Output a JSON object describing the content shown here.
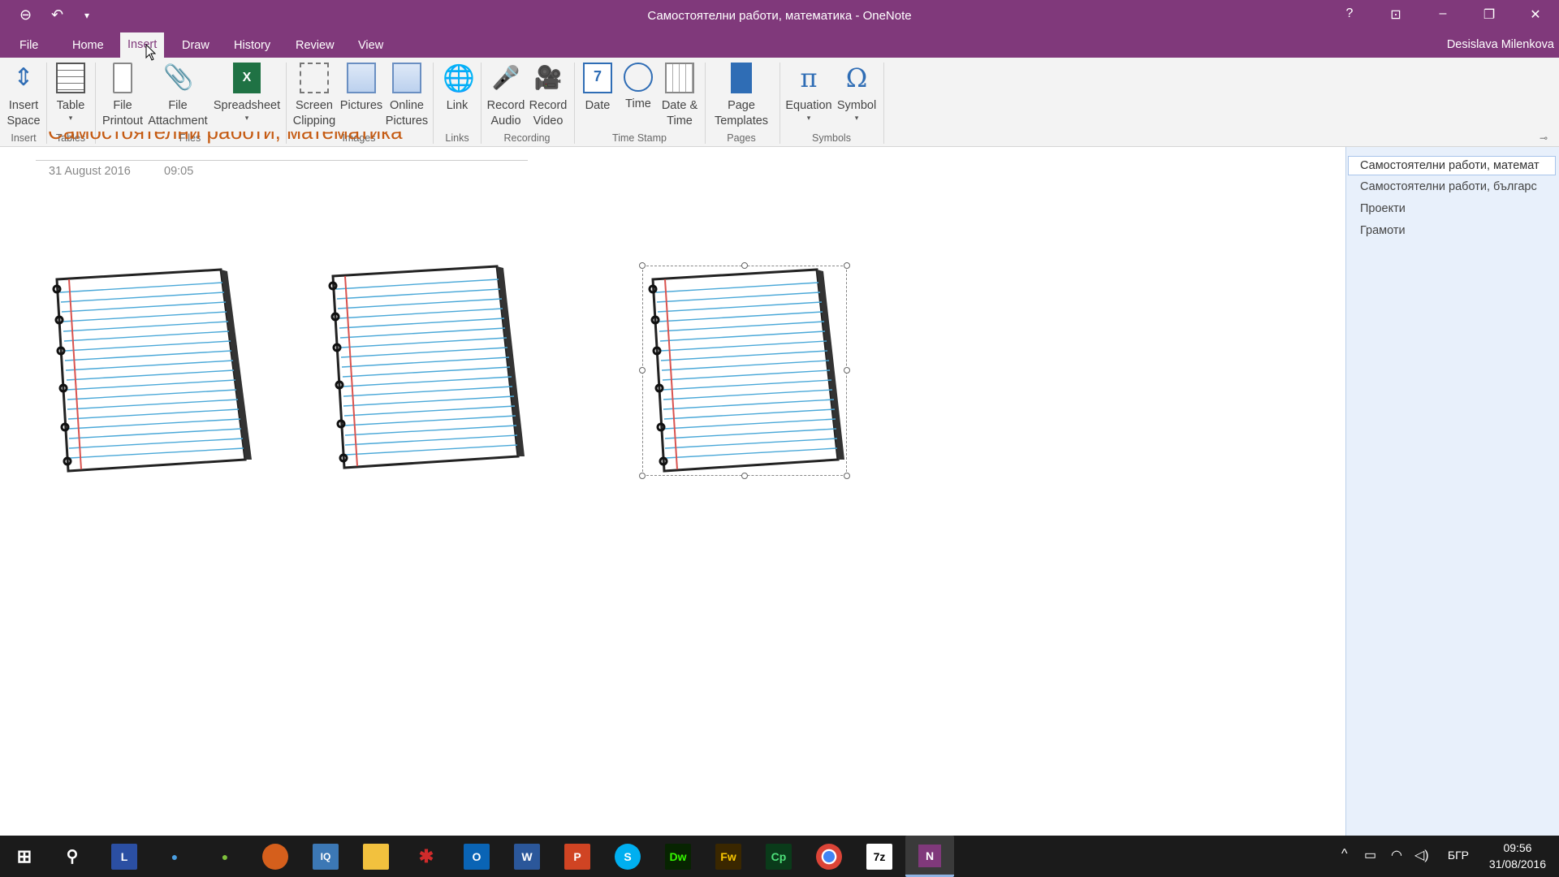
{
  "window": {
    "title": "Самостоятелни работи, математика - OneNote",
    "help": "?",
    "user": "Desislava Milenkova"
  },
  "menu_tabs": [
    "File",
    "Home",
    "Insert",
    "Draw",
    "History",
    "Review",
    "View"
  ],
  "active_tab": "Insert",
  "ribbon": {
    "buttons": {
      "insert_space": "Insert Space",
      "table": "Table",
      "file_printout": "File Printout",
      "file_attachment": "File Attachment",
      "spreadsheet": "Spreadsheet",
      "screen_clipping": "Screen Clipping",
      "pictures": "Pictures",
      "online_pictures": "Online Pictures",
      "link": "Link",
      "record_audio": "Record Audio",
      "record_video": "Record Video",
      "date": "Date",
      "time": "Time",
      "date_time": "Date & Time",
      "page_templates": "Page Templates",
      "equation": "Equation",
      "symbol": "Symbol"
    },
    "groups": {
      "insert": "Insert",
      "tables": "Tables",
      "files": "Files",
      "images": "Images",
      "links": "Links",
      "recording": "Recording",
      "time_stamp": "Time Stamp",
      "pages": "Pages",
      "symbols": "Symbols"
    }
  },
  "page": {
    "title": "Самостоятелни работи, математика",
    "date": "31 August 2016",
    "time": "09:05"
  },
  "pages_pane": {
    "items": [
      "Самостоятелни работи, математ",
      "Самостоятелни работи, българс",
      "Проекти",
      "Грамоти"
    ],
    "selected_index": 0
  },
  "taskbar": {
    "apps": [
      "Start",
      "Search",
      "LibreOffice",
      "Vmware",
      "Tools",
      "Firefox",
      "IQ",
      "File Explorer",
      "Adobe",
      "Outlook",
      "Word",
      "PowerPoint",
      "Skype",
      "Dw",
      "Fw",
      "Cp",
      "Chrome",
      "7z",
      "OneNote"
    ],
    "language": "БГР",
    "clock_time": "09:56",
    "clock_date": "31/08/2016"
  }
}
